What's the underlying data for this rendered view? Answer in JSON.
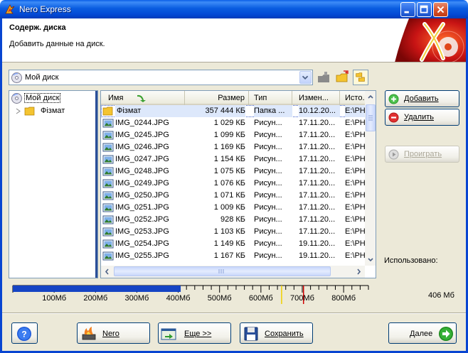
{
  "window": {
    "title": "Nero Express"
  },
  "header": {
    "title": "Содерж. диска",
    "subtitle": "Добавить данные на диск."
  },
  "compilation": {
    "selected": "Мой диск"
  },
  "tree": {
    "root": "Мой диск",
    "folder": "Фізмат"
  },
  "list": {
    "columns": [
      "Имя",
      "Размер",
      "Тип",
      "Измен...",
      "Исто..."
    ],
    "rows": [
      {
        "name": "Фізмат",
        "size": "357 444 КБ",
        "type": "Папка ...",
        "date": "10.12.20...",
        "src": "E:\\PH",
        "kind": "folder",
        "selected": true
      },
      {
        "name": "IMG_0244.JPG",
        "size": "1 029 КБ",
        "type": "Рисун...",
        "date": "17.11.20...",
        "src": "E:\\PH",
        "kind": "image"
      },
      {
        "name": "IMG_0245.JPG",
        "size": "1 099 КБ",
        "type": "Рисун...",
        "date": "17.11.20...",
        "src": "E:\\PH",
        "kind": "image"
      },
      {
        "name": "IMG_0246.JPG",
        "size": "1 169 КБ",
        "type": "Рисун...",
        "date": "17.11.20...",
        "src": "E:\\PH",
        "kind": "image"
      },
      {
        "name": "IMG_0247.JPG",
        "size": "1 154 КБ",
        "type": "Рисун...",
        "date": "17.11.20...",
        "src": "E:\\PH",
        "kind": "image"
      },
      {
        "name": "IMG_0248.JPG",
        "size": "1 075 КБ",
        "type": "Рисун...",
        "date": "17.11.20...",
        "src": "E:\\PH",
        "kind": "image"
      },
      {
        "name": "IMG_0249.JPG",
        "size": "1 076 КБ",
        "type": "Рисун...",
        "date": "17.11.20...",
        "src": "E:\\PH",
        "kind": "image"
      },
      {
        "name": "IMG_0250.JPG",
        "size": "1 071 КБ",
        "type": "Рисун...",
        "date": "17.11.20...",
        "src": "E:\\PH",
        "kind": "image"
      },
      {
        "name": "IMG_0251.JPG",
        "size": "1 009 КБ",
        "type": "Рисун...",
        "date": "17.11.20...",
        "src": "E:\\PH",
        "kind": "image"
      },
      {
        "name": "IMG_0252.JPG",
        "size": "928 КБ",
        "type": "Рисун...",
        "date": "17.11.20...",
        "src": "E:\\PH",
        "kind": "image"
      },
      {
        "name": "IMG_0253.JPG",
        "size": "1 103 КБ",
        "type": "Рисун...",
        "date": "17.11.20...",
        "src": "E:\\PH",
        "kind": "image"
      },
      {
        "name": "IMG_0254.JPG",
        "size": "1 149 КБ",
        "type": "Рисун...",
        "date": "19.11.20...",
        "src": "E:\\PH",
        "kind": "image"
      },
      {
        "name": "IMG_0255.JPG",
        "size": "1 167 КБ",
        "type": "Рисун...",
        "date": "19.11.20...",
        "src": "E:\\PH",
        "kind": "image"
      }
    ]
  },
  "actions": {
    "add": "Добавить",
    "delete": "Удалить",
    "play": "Проиграть"
  },
  "usage": {
    "label": "Использовано:",
    "disc_size": "406 Мб",
    "scale_labels": [
      "100Мб",
      "200Мб",
      "300Мб",
      "400Мб",
      "500Мб",
      "600Мб",
      "700Мб",
      "800Мб"
    ],
    "used_mb": 406,
    "max_mb": 860,
    "marker_yellow_mb": 650,
    "marker_red_mb": 703
  },
  "buttons": {
    "help": "?",
    "nero": "Nero",
    "more": "Еще >>",
    "save": "Сохранить",
    "next": "Далее"
  },
  "colors": {
    "titlebar": "#0a5de0",
    "capacity_fill": "#1544c4",
    "selection": "#dde8fb"
  }
}
